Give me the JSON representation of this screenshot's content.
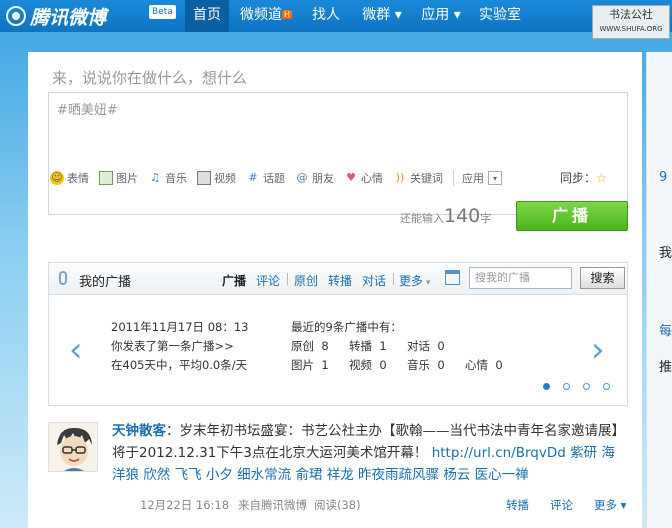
{
  "header": {
    "logo_text": "腾讯微博",
    "beta": "Beta",
    "nav": [
      {
        "label": "首页",
        "active": true
      },
      {
        "label": "微频道",
        "badge": "H"
      },
      {
        "label": "找人"
      },
      {
        "label": "微群 ▾"
      },
      {
        "label": "应用 ▾"
      },
      {
        "label": "实验室"
      }
    ],
    "watermark_title": "书法公社",
    "watermark_url": "WWW.SHUFA.ORG"
  },
  "compose": {
    "prompt": "来，说说你在做什么，想什么",
    "value": "#晒美妞#",
    "tools": [
      "表情",
      "图片",
      "音乐",
      "视频",
      "话题",
      "朋友",
      "心情",
      "关键词"
    ],
    "apps": "应用",
    "sync": "同步：",
    "remain_prefix": "还能输入",
    "remain_count": "140",
    "remain_suffix": "字",
    "post_button": "广播"
  },
  "feed": {
    "title": "我的广播",
    "tabs": [
      "广播",
      "评论",
      "原创",
      "转播",
      "对话",
      "更多"
    ],
    "search_placeholder": "搜我的广播",
    "search_button": "搜索",
    "stats": {
      "date": "2011年11月17日  08：13",
      "first_post": "你发表了第一条广播>>",
      "average": "在405天中，平均0.0条/天",
      "recent": "最近的9条广播中有：",
      "row1": [
        [
          "原创",
          "8"
        ],
        [
          "转播",
          "1"
        ],
        [
          "对话",
          "0"
        ]
      ],
      "row2": [
        [
          "图片",
          "1"
        ],
        [
          "视频",
          "0"
        ],
        [
          "音乐",
          "0"
        ],
        [
          "心情",
          "0"
        ]
      ]
    },
    "post": {
      "user": "天钟散客",
      "text1": "：岁末年初书坛盛宴：书艺公社主办【歌翰——当代书法中青年名家邀请展】将于2012.12.31下午3点在北京大运河美术馆开幕！",
      "link": "http://url.cn/BrqvDd",
      "mentions": "紫研 海洋狼 欣然 飞飞 小夕 细水常流 俞珺 祥龙 昨夜雨疏风骤 杨云 医心一禅",
      "time": "12月22日  16:18",
      "source": "来自腾讯微博",
      "read": "阅读(38)",
      "actions": [
        "转播",
        "评论",
        "更多 ▾"
      ]
    }
  },
  "right_panel": {
    "items": [
      "9",
      "我",
      "每",
      "推"
    ]
  }
}
